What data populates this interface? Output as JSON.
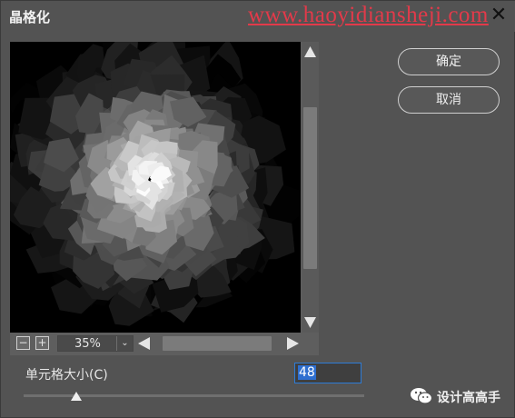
{
  "window": {
    "title": "晶格化",
    "watermark": "www.haoyidiansheji.com",
    "close_symbol": "✕"
  },
  "preview": {
    "zoom_out_symbol": "−",
    "zoom_in_symbol": "+",
    "zoom_level": "35%",
    "zoom_dropdown_symbol": "⌄"
  },
  "buttons": {
    "ok_label": "确定",
    "cancel_label": "取消"
  },
  "parameter": {
    "label": "单元格大小(C)",
    "value": "48",
    "slider_value": 48,
    "slider_min": 3,
    "slider_max": 300
  },
  "branding": {
    "text": "设计高高手",
    "icon": "wechat-icon"
  },
  "colors": {
    "background": "#535353",
    "watermark": "#e23a4a",
    "input_focus": "#2e7cd6"
  }
}
